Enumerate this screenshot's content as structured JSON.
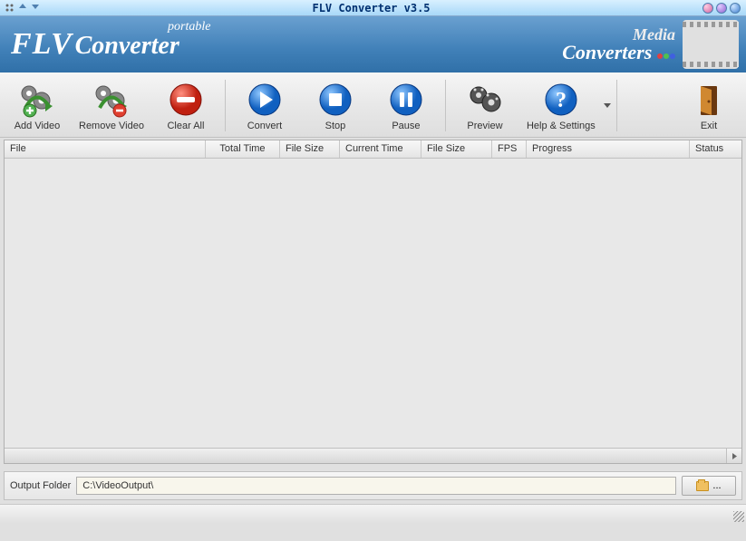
{
  "title": "FLV Converter v3.5",
  "banner": {
    "flv": "FLV",
    "converter": "Converter",
    "portable": "portable",
    "brand_media": "Media",
    "brand_converters": "Converters"
  },
  "toolbar": {
    "add_video": "Add Video",
    "remove_video": "Remove Video",
    "clear_all": "Clear All",
    "convert": "Convert",
    "stop": "Stop",
    "pause": "Pause",
    "preview": "Preview",
    "help_settings": "Help & Settings",
    "exit": "Exit"
  },
  "columns": {
    "file": "File",
    "total_time": "Total Time",
    "file_size": "File Size",
    "current_time": "Current Time",
    "file_size2": "File Size",
    "fps": "FPS",
    "progress": "Progress",
    "status": "Status"
  },
  "column_widths": {
    "file": 222,
    "total_time": 82,
    "file_size": 66,
    "current_time": 90,
    "file_size2": 78,
    "fps": 38,
    "progress": 180,
    "status": 48
  },
  "output": {
    "label": "Output Folder",
    "value": "C:\\VideoOutput\\",
    "browse_dots": "..."
  },
  "rows": []
}
